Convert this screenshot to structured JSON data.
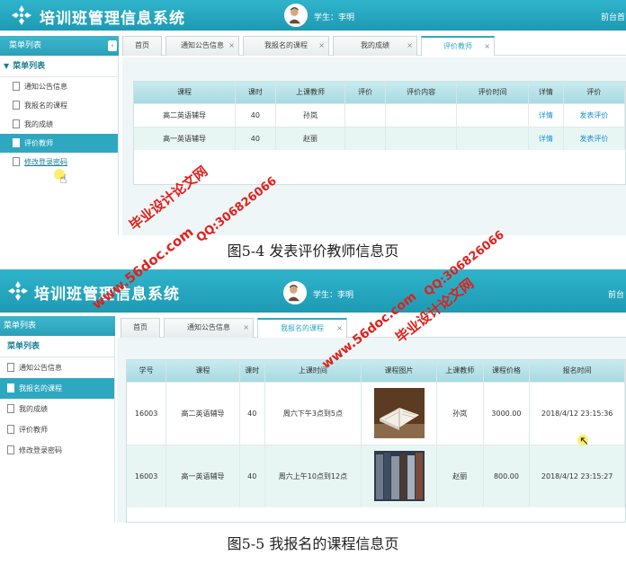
{
  "app": {
    "title": "培训班管理信息系统",
    "user_label": "学生：李明",
    "home_link": "前台首",
    "home_link_2": "前台"
  },
  "sidebar": {
    "header": "菜单列表",
    "group": "菜单列表",
    "items": [
      "通知公告信息",
      "我报名的课程",
      "我的成绩",
      "评价教师",
      "修改登录密码"
    ]
  },
  "screen1": {
    "tabs": [
      "首页",
      "通知公告信息",
      "我报名的课程",
      "我的成绩",
      "评价教师"
    ],
    "table": {
      "headers": [
        "课程",
        "课时",
        "上课教师",
        "评价",
        "评价内容",
        "评价时间",
        "详情",
        "评价"
      ],
      "rows": [
        [
          "高二英语辅导",
          "40",
          "孙岚",
          "",
          "",
          "",
          "详情",
          "发表评价"
        ],
        [
          "高一英语辅导",
          "40",
          "赵丽",
          "",
          "",
          "",
          "详情",
          "发表评价"
        ]
      ]
    },
    "caption": "图5-4  发表评价教师信息页"
  },
  "screen2": {
    "tabs": [
      "首页",
      "通知公告信息",
      "我报名的课程"
    ],
    "table": {
      "headers": [
        "学号",
        "课程",
        "课时",
        "上课时间",
        "课程图片",
        "上课教师",
        "课程价格",
        "报名时间"
      ],
      "rows": [
        [
          "16003",
          "高二英语辅导",
          "40",
          "周六下午3点到5点",
          "book-image",
          "孙岚",
          "3000.00",
          "2018/4/12 23:15:36"
        ],
        [
          "16003",
          "高一英语辅导",
          "40",
          "周六上午10点到12点",
          "bookshelf-image",
          "赵丽",
          "800.00",
          "2018/4/12 23:15:27"
        ]
      ]
    },
    "caption": "图5-5  我报名的课程信息页"
  },
  "watermarks": {
    "a": "毕业设计论文网",
    "b": "www.56doc.com",
    "c": "QQ:306826066"
  },
  "colors": {
    "header": "#2fb4cc",
    "accent": "#2ea8c0",
    "watermark": "#e0201c"
  }
}
